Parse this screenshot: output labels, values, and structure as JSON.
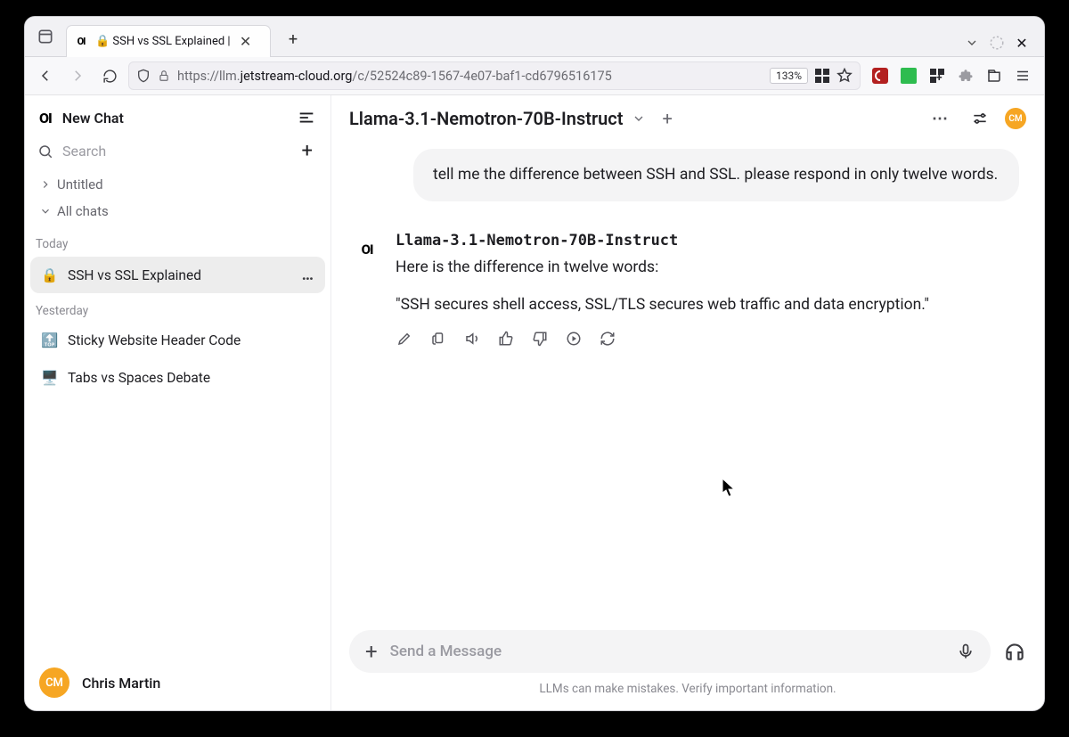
{
  "browser": {
    "tab_title": "🔒 SSH vs SSL Explained |",
    "url_prefix": "https://llm.",
    "url_domain": "jetstream-cloud.org",
    "url_path": "/c/52524c89-1567-4e07-baf1-cd6796516175",
    "zoom": "133%"
  },
  "sidebar": {
    "new_chat": "New Chat",
    "search_placeholder": "Search",
    "untitled": "Untitled",
    "all_chats": "All chats",
    "today_label": "Today",
    "yesterday_label": "Yesterday",
    "today": [
      {
        "emoji": "🔒",
        "title": "SSH vs SSL Explained",
        "active": true
      }
    ],
    "yesterday": [
      {
        "emoji": "🔝",
        "title": "Sticky Website Header Code"
      },
      {
        "emoji": "🖥️",
        "title": "Tabs vs Spaces Debate"
      }
    ],
    "user": {
      "initials": "CM",
      "name": "Chris Martin"
    }
  },
  "main": {
    "model": "Llama-3.1-Nemotron-70B-Instruct",
    "user_message": "tell me the difference between SSH and SSL. please respond in only twelve words.",
    "assistant_name": "Llama-3.1-Nemotron-70B-Instruct",
    "assistant_p1": "Here is the difference in twelve words:",
    "assistant_p2": "\"SSH secures shell access, SSL/TLS secures web traffic and data encryption.\"",
    "compose_placeholder": "Send a Message",
    "disclaimer": "LLMs can make mistakes. Verify important information."
  }
}
